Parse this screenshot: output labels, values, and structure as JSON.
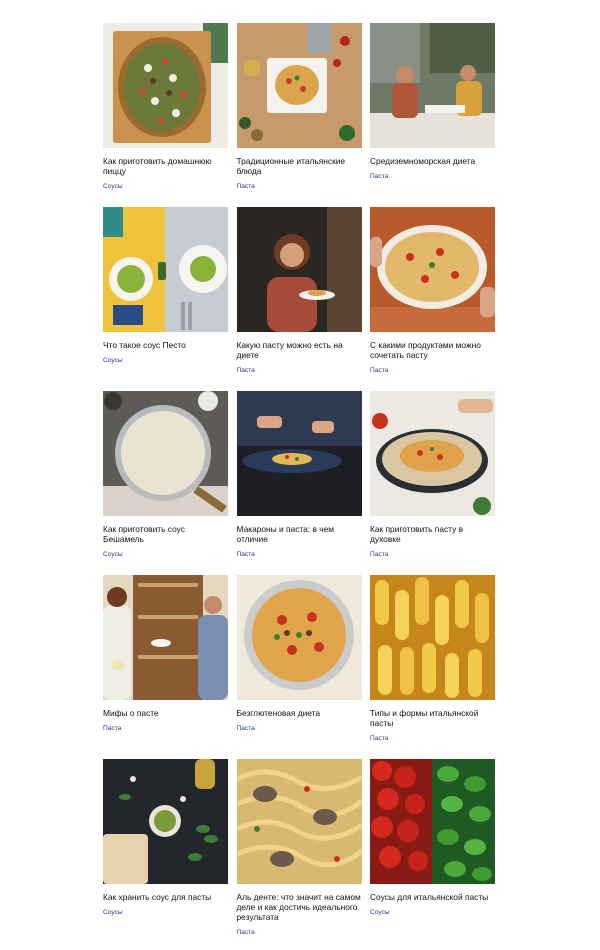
{
  "cards": [
    {
      "title": "Как приготовить домашнюю пиццу",
      "tag": "Соусы",
      "image": "pizza-photo"
    },
    {
      "title": "Традиционные итальянские блюда",
      "tag": "Паста",
      "image": "italian-dishes-photo"
    },
    {
      "title": "Средиземноморская диета",
      "tag": "Паста",
      "image": "dinner-table-photo"
    },
    {
      "title": "Что такое соус Песто",
      "tag": "Соусы",
      "image": "pesto-pasta-photo"
    },
    {
      "title": "Какую пасту можно есть на диете",
      "tag": "Паста",
      "image": "woman-eating-pasta-photo"
    },
    {
      "title": "С какими продуктами можно сочетать пасту",
      "tag": "Паста",
      "image": "penne-dish-photo"
    },
    {
      "title": "Как приготовить соус Бешамель",
      "tag": "Соусы",
      "image": "bechamel-pan-photo"
    },
    {
      "title": "Макароны и паста: в чем отличие",
      "tag": "Паста",
      "image": "pasta-plate-photo"
    },
    {
      "title": "Как приготовить пасту в духовке",
      "tag": "Паста",
      "image": "baked-pasta-photo"
    },
    {
      "title": "Мифы о пасте",
      "tag": "Паста",
      "image": "kitchen-people-photo"
    },
    {
      "title": "Безглютеновая диета",
      "tag": "Паста",
      "image": "penne-bowl-photo"
    },
    {
      "title": "Типы и формы итальянской пасты",
      "tag": "Паста",
      "image": "fusilli-photo"
    },
    {
      "title": "Как хранить соус для пасты",
      "tag": "Соусы",
      "image": "pesto-bowl-photo"
    },
    {
      "title": "Аль денте: что значит на самом деле и как достичь идеального результата",
      "tag": "Паста",
      "image": "spaghetti-clams-photo"
    },
    {
      "title": "Соусы для итальянской пасты",
      "tag": "Соусы",
      "image": "tomatoes-basil-photo"
    }
  ]
}
